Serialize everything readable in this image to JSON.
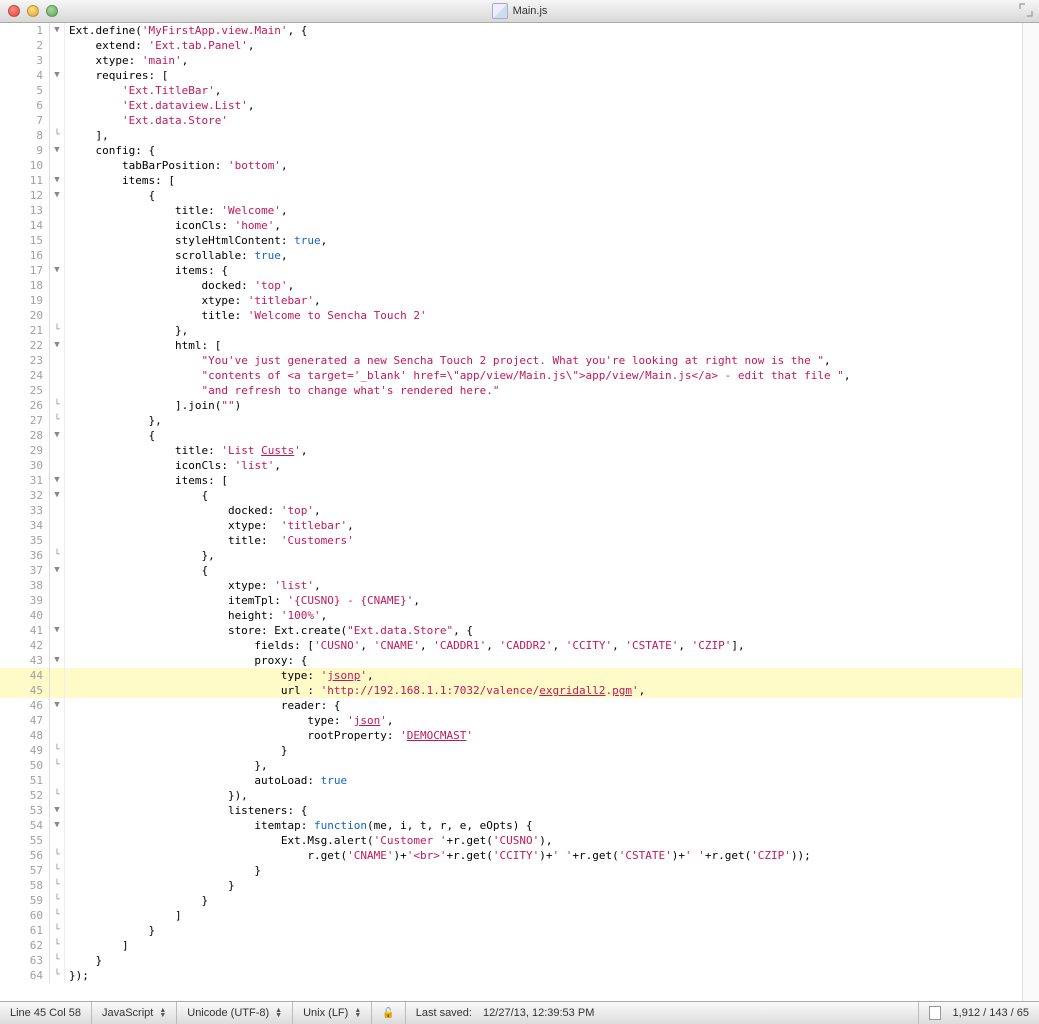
{
  "title_file": "Main.js",
  "code_lines": [
    {
      "n": 1,
      "fold": "▼",
      "hl": false,
      "segs": [
        "Ext.define(",
        [
          "k",
          "'MyFirstApp.view.Main'"
        ],
        ", {"
      ]
    },
    {
      "n": 2,
      "fold": "",
      "hl": false,
      "segs": [
        "    extend: ",
        [
          "k",
          "'Ext.tab.Panel'"
        ],
        ","
      ]
    },
    {
      "n": 3,
      "fold": "",
      "hl": false,
      "segs": [
        "    xtype: ",
        [
          "k",
          "'main'"
        ],
        ","
      ]
    },
    {
      "n": 4,
      "fold": "▼",
      "hl": false,
      "segs": [
        "    requires: ["
      ]
    },
    {
      "n": 5,
      "fold": "",
      "hl": false,
      "segs": [
        "        ",
        [
          "k",
          "'Ext.TitleBar'"
        ],
        ","
      ]
    },
    {
      "n": 6,
      "fold": "",
      "hl": false,
      "segs": [
        "        ",
        [
          "k",
          "'Ext.dataview.List'"
        ],
        ","
      ]
    },
    {
      "n": 7,
      "fold": "",
      "hl": false,
      "segs": [
        "        ",
        [
          "k",
          "'Ext.data.Store'"
        ]
      ]
    },
    {
      "n": 8,
      "fold": "└",
      "hl": false,
      "segs": [
        "    ],"
      ]
    },
    {
      "n": 9,
      "fold": "▼",
      "hl": false,
      "segs": [
        "    config: {"
      ]
    },
    {
      "n": 10,
      "fold": "",
      "hl": false,
      "segs": [
        "        tabBarPosition: ",
        [
          "k",
          "'bottom'"
        ],
        ","
      ]
    },
    {
      "n": 11,
      "fold": "▼",
      "hl": false,
      "segs": [
        "        items: ["
      ]
    },
    {
      "n": 12,
      "fold": "▼",
      "hl": false,
      "segs": [
        "            {"
      ]
    },
    {
      "n": 13,
      "fold": "",
      "hl": false,
      "segs": [
        "                title: ",
        [
          "k",
          "'Welcome'"
        ],
        ","
      ]
    },
    {
      "n": 14,
      "fold": "",
      "hl": false,
      "segs": [
        "                iconCls: ",
        [
          "k",
          "'home'"
        ],
        ","
      ]
    },
    {
      "n": 15,
      "fold": "",
      "hl": false,
      "segs": [
        "                styleHtmlContent: ",
        [
          "n",
          "true"
        ],
        ","
      ]
    },
    {
      "n": 16,
      "fold": "",
      "hl": false,
      "segs": [
        "                scrollable: ",
        [
          "n",
          "true"
        ],
        ","
      ]
    },
    {
      "n": 17,
      "fold": "▼",
      "hl": false,
      "segs": [
        "                items: {"
      ]
    },
    {
      "n": 18,
      "fold": "",
      "hl": false,
      "segs": [
        "                    docked: ",
        [
          "k",
          "'top'"
        ],
        ","
      ]
    },
    {
      "n": 19,
      "fold": "",
      "hl": false,
      "segs": [
        "                    xtype: ",
        [
          "k",
          "'titlebar'"
        ],
        ","
      ]
    },
    {
      "n": 20,
      "fold": "",
      "hl": false,
      "segs": [
        "                    title: ",
        [
          "k",
          "'Welcome to Sencha Touch 2'"
        ]
      ]
    },
    {
      "n": 21,
      "fold": "└",
      "hl": false,
      "segs": [
        "                },"
      ]
    },
    {
      "n": 22,
      "fold": "▼",
      "hl": false,
      "segs": [
        "                html: ["
      ]
    },
    {
      "n": 23,
      "fold": "",
      "hl": false,
      "segs": [
        "                    ",
        [
          "k",
          "\"You've just generated a new Sencha Touch 2 project. What you're looking at right now is the \""
        ],
        ","
      ]
    },
    {
      "n": 24,
      "fold": "",
      "hl": false,
      "segs": [
        "                    ",
        [
          "k",
          "\"contents of <a target='_blank' href=\\\"app/view/Main.js\\\">app/view/Main.js</a> - edit that file \""
        ],
        ","
      ]
    },
    {
      "n": 25,
      "fold": "",
      "hl": false,
      "segs": [
        "                    ",
        [
          "k",
          "\"and refresh to change what's rendered here.\""
        ]
      ]
    },
    {
      "n": 26,
      "fold": "└",
      "hl": false,
      "segs": [
        "                ].join(",
        [
          "k",
          "\"\""
        ],
        ")"
      ]
    },
    {
      "n": 27,
      "fold": "└",
      "hl": false,
      "segs": [
        "            },"
      ]
    },
    {
      "n": 28,
      "fold": "▼",
      "hl": false,
      "segs": [
        "            {"
      ]
    },
    {
      "n": 29,
      "fold": "",
      "hl": false,
      "segs": [
        "                title: ",
        [
          "k",
          "'List "
        ],
        [
          "ku",
          "Custs"
        ],
        [
          "k",
          "'"
        ],
        ","
      ]
    },
    {
      "n": 30,
      "fold": "",
      "hl": false,
      "segs": [
        "                iconCls: ",
        [
          "k",
          "'list'"
        ],
        ","
      ]
    },
    {
      "n": 31,
      "fold": "▼",
      "hl": false,
      "segs": [
        "                items: ["
      ]
    },
    {
      "n": 32,
      "fold": "▼",
      "hl": false,
      "segs": [
        "                    {"
      ]
    },
    {
      "n": 33,
      "fold": "",
      "hl": false,
      "segs": [
        "                        docked: ",
        [
          "k",
          "'top'"
        ],
        ","
      ]
    },
    {
      "n": 34,
      "fold": "",
      "hl": false,
      "segs": [
        "                        xtype:  ",
        [
          "k",
          "'titlebar'"
        ],
        ","
      ]
    },
    {
      "n": 35,
      "fold": "",
      "hl": false,
      "segs": [
        "                        title:  ",
        [
          "k",
          "'Customers'"
        ]
      ]
    },
    {
      "n": 36,
      "fold": "└",
      "hl": false,
      "segs": [
        "                    },"
      ]
    },
    {
      "n": 37,
      "fold": "▼",
      "hl": false,
      "segs": [
        "                    {"
      ]
    },
    {
      "n": 38,
      "fold": "",
      "hl": false,
      "segs": [
        "                        xtype: ",
        [
          "k",
          "'list'"
        ],
        ","
      ]
    },
    {
      "n": 39,
      "fold": "",
      "hl": false,
      "segs": [
        "                        itemTpl: ",
        [
          "k",
          "'{CUSNO} - {CNAME}'"
        ],
        ","
      ]
    },
    {
      "n": 40,
      "fold": "",
      "hl": false,
      "segs": [
        "                        height: ",
        [
          "k",
          "'100%'"
        ],
        ","
      ]
    },
    {
      "n": 41,
      "fold": "▼",
      "hl": false,
      "segs": [
        "                        store: Ext.create(",
        [
          "k",
          "\"Ext.data.Store\""
        ],
        ", {"
      ]
    },
    {
      "n": 42,
      "fold": "",
      "hl": false,
      "segs": [
        "                            fields: [",
        [
          "k",
          "'CUSNO'"
        ],
        ", ",
        [
          "k",
          "'CNAME'"
        ],
        ", ",
        [
          "k",
          "'CADDR1'"
        ],
        ", ",
        [
          "k",
          "'CADDR2'"
        ],
        ", ",
        [
          "k",
          "'CCITY'"
        ],
        ", ",
        [
          "k",
          "'CSTATE'"
        ],
        ", ",
        [
          "k",
          "'CZIP'"
        ],
        "],"
      ]
    },
    {
      "n": 43,
      "fold": "▼",
      "hl": false,
      "segs": [
        "                            proxy: {"
      ]
    },
    {
      "n": 44,
      "fold": "",
      "hl": true,
      "segs": [
        "                                type: ",
        [
          "k",
          "'"
        ],
        [
          "ku",
          "jsonp"
        ],
        [
          "k",
          "'"
        ],
        ","
      ]
    },
    {
      "n": 45,
      "fold": "",
      "hl": true,
      "segs": [
        "                                url : ",
        [
          "k",
          "'http://192.168.1.1:7032/valence/"
        ],
        [
          "ku",
          "exgridall2"
        ],
        [
          "k",
          "."
        ],
        [
          "ku",
          "pgm"
        ],
        [
          "k",
          "'"
        ],
        ","
      ]
    },
    {
      "n": 46,
      "fold": "▼",
      "hl": false,
      "segs": [
        "                                reader: {"
      ]
    },
    {
      "n": 47,
      "fold": "",
      "hl": false,
      "segs": [
        "                                    type: ",
        [
          "k",
          "'"
        ],
        [
          "ku",
          "json"
        ],
        [
          "k",
          "'"
        ],
        ","
      ]
    },
    {
      "n": 48,
      "fold": "",
      "hl": false,
      "segs": [
        "                                    rootProperty: ",
        [
          "k",
          "'"
        ],
        [
          "ku",
          "DEMOCMAST"
        ],
        [
          "k",
          "'"
        ]
      ]
    },
    {
      "n": 49,
      "fold": "└",
      "hl": false,
      "segs": [
        "                                }"
      ]
    },
    {
      "n": 50,
      "fold": "└",
      "hl": false,
      "segs": [
        "                            },"
      ]
    },
    {
      "n": 51,
      "fold": "",
      "hl": false,
      "segs": [
        "                            autoLoad: ",
        [
          "n",
          "true"
        ]
      ]
    },
    {
      "n": 52,
      "fold": "└",
      "hl": false,
      "segs": [
        "                        }),"
      ]
    },
    {
      "n": 53,
      "fold": "▼",
      "hl": false,
      "segs": [
        "                        listeners: {"
      ]
    },
    {
      "n": 54,
      "fold": "▼",
      "hl": false,
      "segs": [
        "                            itemtap: ",
        [
          "fn",
          "function"
        ],
        "(me, i, t, r, e, eOpts) {"
      ]
    },
    {
      "n": 55,
      "fold": "",
      "hl": false,
      "segs": [
        "                                Ext.Msg.alert(",
        [
          "k",
          "'Customer '"
        ],
        "+r.get(",
        [
          "k",
          "'CUSNO'"
        ],
        "),"
      ]
    },
    {
      "n": 56,
      "fold": "└",
      "hl": false,
      "segs": [
        "                                    r.get(",
        [
          "k",
          "'CNAME'"
        ],
        ")+",
        [
          "k",
          "'<br>'"
        ],
        "+r.get(",
        [
          "k",
          "'CCITY'"
        ],
        ")+",
        [
          "k",
          "' '"
        ],
        "+r.get(",
        [
          "k",
          "'CSTATE'"
        ],
        ")+",
        [
          "k",
          "' '"
        ],
        "+r.get(",
        [
          "k",
          "'CZIP'"
        ],
        "));"
      ]
    },
    {
      "n": 57,
      "fold": "└",
      "hl": false,
      "segs": [
        "                            }"
      ]
    },
    {
      "n": 58,
      "fold": "└",
      "hl": false,
      "segs": [
        "                        }"
      ]
    },
    {
      "n": 59,
      "fold": "└",
      "hl": false,
      "segs": [
        "                    }"
      ]
    },
    {
      "n": 60,
      "fold": "└",
      "hl": false,
      "segs": [
        "                ]"
      ]
    },
    {
      "n": 61,
      "fold": "└",
      "hl": false,
      "segs": [
        "            }"
      ]
    },
    {
      "n": 62,
      "fold": "└",
      "hl": false,
      "segs": [
        "        ]"
      ]
    },
    {
      "n": 63,
      "fold": "└",
      "hl": false,
      "segs": [
        "    }"
      ]
    },
    {
      "n": 64,
      "fold": "└",
      "hl": false,
      "segs": [
        "});"
      ]
    }
  ],
  "status": {
    "cursor": "Line 45 Col 58",
    "language": "JavaScript",
    "encoding": "Unicode (UTF-8)",
    "line_endings": "Unix (LF)",
    "last_saved_label": "Last saved:",
    "last_saved": "12/27/13, 12:39:53 PM",
    "doc_stats": "1,912 / 143 / 65"
  }
}
